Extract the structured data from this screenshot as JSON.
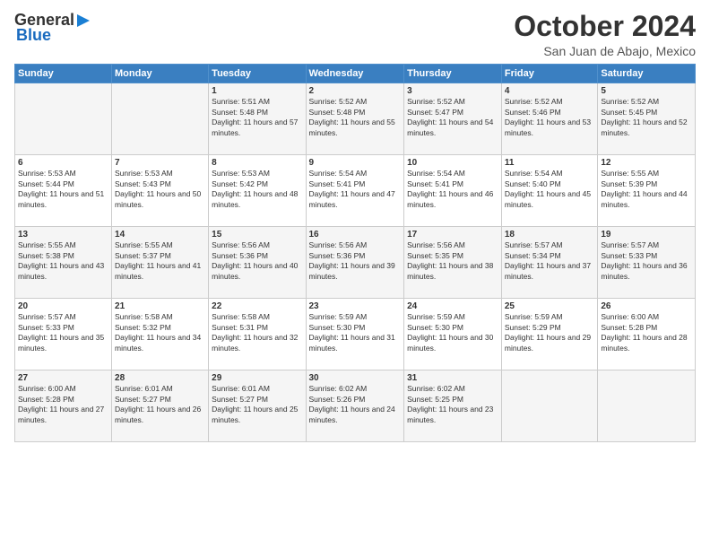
{
  "logo": {
    "general": "General",
    "blue": "Blue"
  },
  "title": "October 2024",
  "location": "San Juan de Abajo, Mexico",
  "days_of_week": [
    "Sunday",
    "Monday",
    "Tuesday",
    "Wednesday",
    "Thursday",
    "Friday",
    "Saturday"
  ],
  "weeks": [
    [
      {
        "day": "",
        "info": ""
      },
      {
        "day": "",
        "info": ""
      },
      {
        "day": "1",
        "info": "Sunrise: 5:51 AM\nSunset: 5:48 PM\nDaylight: 11 hours and 57 minutes."
      },
      {
        "day": "2",
        "info": "Sunrise: 5:52 AM\nSunset: 5:48 PM\nDaylight: 11 hours and 55 minutes."
      },
      {
        "day": "3",
        "info": "Sunrise: 5:52 AM\nSunset: 5:47 PM\nDaylight: 11 hours and 54 minutes."
      },
      {
        "day": "4",
        "info": "Sunrise: 5:52 AM\nSunset: 5:46 PM\nDaylight: 11 hours and 53 minutes."
      },
      {
        "day": "5",
        "info": "Sunrise: 5:52 AM\nSunset: 5:45 PM\nDaylight: 11 hours and 52 minutes."
      }
    ],
    [
      {
        "day": "6",
        "info": "Sunrise: 5:53 AM\nSunset: 5:44 PM\nDaylight: 11 hours and 51 minutes."
      },
      {
        "day": "7",
        "info": "Sunrise: 5:53 AM\nSunset: 5:43 PM\nDaylight: 11 hours and 50 minutes."
      },
      {
        "day": "8",
        "info": "Sunrise: 5:53 AM\nSunset: 5:42 PM\nDaylight: 11 hours and 48 minutes."
      },
      {
        "day": "9",
        "info": "Sunrise: 5:54 AM\nSunset: 5:41 PM\nDaylight: 11 hours and 47 minutes."
      },
      {
        "day": "10",
        "info": "Sunrise: 5:54 AM\nSunset: 5:41 PM\nDaylight: 11 hours and 46 minutes."
      },
      {
        "day": "11",
        "info": "Sunrise: 5:54 AM\nSunset: 5:40 PM\nDaylight: 11 hours and 45 minutes."
      },
      {
        "day": "12",
        "info": "Sunrise: 5:55 AM\nSunset: 5:39 PM\nDaylight: 11 hours and 44 minutes."
      }
    ],
    [
      {
        "day": "13",
        "info": "Sunrise: 5:55 AM\nSunset: 5:38 PM\nDaylight: 11 hours and 43 minutes."
      },
      {
        "day": "14",
        "info": "Sunrise: 5:55 AM\nSunset: 5:37 PM\nDaylight: 11 hours and 41 minutes."
      },
      {
        "day": "15",
        "info": "Sunrise: 5:56 AM\nSunset: 5:36 PM\nDaylight: 11 hours and 40 minutes."
      },
      {
        "day": "16",
        "info": "Sunrise: 5:56 AM\nSunset: 5:36 PM\nDaylight: 11 hours and 39 minutes."
      },
      {
        "day": "17",
        "info": "Sunrise: 5:56 AM\nSunset: 5:35 PM\nDaylight: 11 hours and 38 minutes."
      },
      {
        "day": "18",
        "info": "Sunrise: 5:57 AM\nSunset: 5:34 PM\nDaylight: 11 hours and 37 minutes."
      },
      {
        "day": "19",
        "info": "Sunrise: 5:57 AM\nSunset: 5:33 PM\nDaylight: 11 hours and 36 minutes."
      }
    ],
    [
      {
        "day": "20",
        "info": "Sunrise: 5:57 AM\nSunset: 5:33 PM\nDaylight: 11 hours and 35 minutes."
      },
      {
        "day": "21",
        "info": "Sunrise: 5:58 AM\nSunset: 5:32 PM\nDaylight: 11 hours and 34 minutes."
      },
      {
        "day": "22",
        "info": "Sunrise: 5:58 AM\nSunset: 5:31 PM\nDaylight: 11 hours and 32 minutes."
      },
      {
        "day": "23",
        "info": "Sunrise: 5:59 AM\nSunset: 5:30 PM\nDaylight: 11 hours and 31 minutes."
      },
      {
        "day": "24",
        "info": "Sunrise: 5:59 AM\nSunset: 5:30 PM\nDaylight: 11 hours and 30 minutes."
      },
      {
        "day": "25",
        "info": "Sunrise: 5:59 AM\nSunset: 5:29 PM\nDaylight: 11 hours and 29 minutes."
      },
      {
        "day": "26",
        "info": "Sunrise: 6:00 AM\nSunset: 5:28 PM\nDaylight: 11 hours and 28 minutes."
      }
    ],
    [
      {
        "day": "27",
        "info": "Sunrise: 6:00 AM\nSunset: 5:28 PM\nDaylight: 11 hours and 27 minutes."
      },
      {
        "day": "28",
        "info": "Sunrise: 6:01 AM\nSunset: 5:27 PM\nDaylight: 11 hours and 26 minutes."
      },
      {
        "day": "29",
        "info": "Sunrise: 6:01 AM\nSunset: 5:27 PM\nDaylight: 11 hours and 25 minutes."
      },
      {
        "day": "30",
        "info": "Sunrise: 6:02 AM\nSunset: 5:26 PM\nDaylight: 11 hours and 24 minutes."
      },
      {
        "day": "31",
        "info": "Sunrise: 6:02 AM\nSunset: 5:25 PM\nDaylight: 11 hours and 23 minutes."
      },
      {
        "day": "",
        "info": ""
      },
      {
        "day": "",
        "info": ""
      }
    ]
  ]
}
